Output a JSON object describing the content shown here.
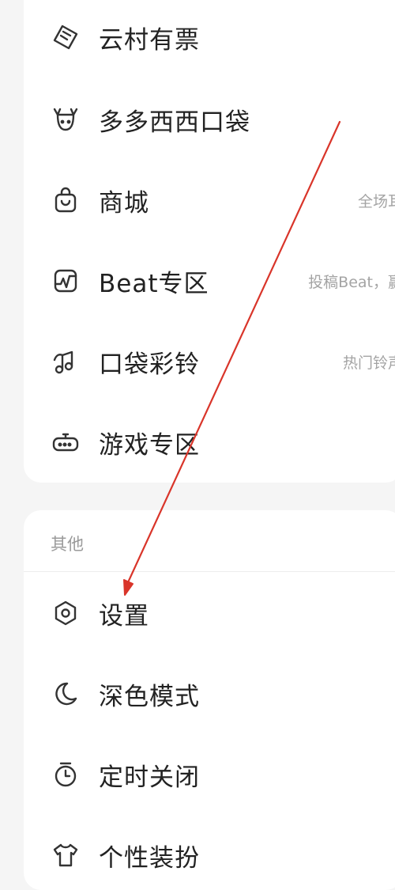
{
  "menu_top": {
    "items": [
      {
        "label": "云村有票",
        "hint": "",
        "icon": "ticket-icon"
      },
      {
        "label": "多多西西口袋",
        "hint": "",
        "icon": "deer-icon"
      },
      {
        "label": "商城",
        "hint": "全场耳",
        "icon": "shopping-bag-icon"
      },
      {
        "label": "Beat专区",
        "hint": "投稿Beat，赢",
        "icon": "waveform-icon"
      },
      {
        "label": "口袋彩铃",
        "hint": "热门铃声",
        "icon": "music-note-icon"
      },
      {
        "label": "游戏专区",
        "hint": "",
        "icon": "gamepad-icon"
      }
    ]
  },
  "menu_other": {
    "title": "其他",
    "items": [
      {
        "label": "设置",
        "icon": "settings-hexagon-icon"
      },
      {
        "label": "深色模式",
        "icon": "moon-icon"
      },
      {
        "label": "定时关闭",
        "icon": "timer-icon"
      },
      {
        "label": "个性装扮",
        "icon": "tshirt-icon"
      }
    ]
  },
  "colors": {
    "annotation_arrow": "#d9352a",
    "text": "#222222",
    "hint": "#a4a4a4"
  }
}
